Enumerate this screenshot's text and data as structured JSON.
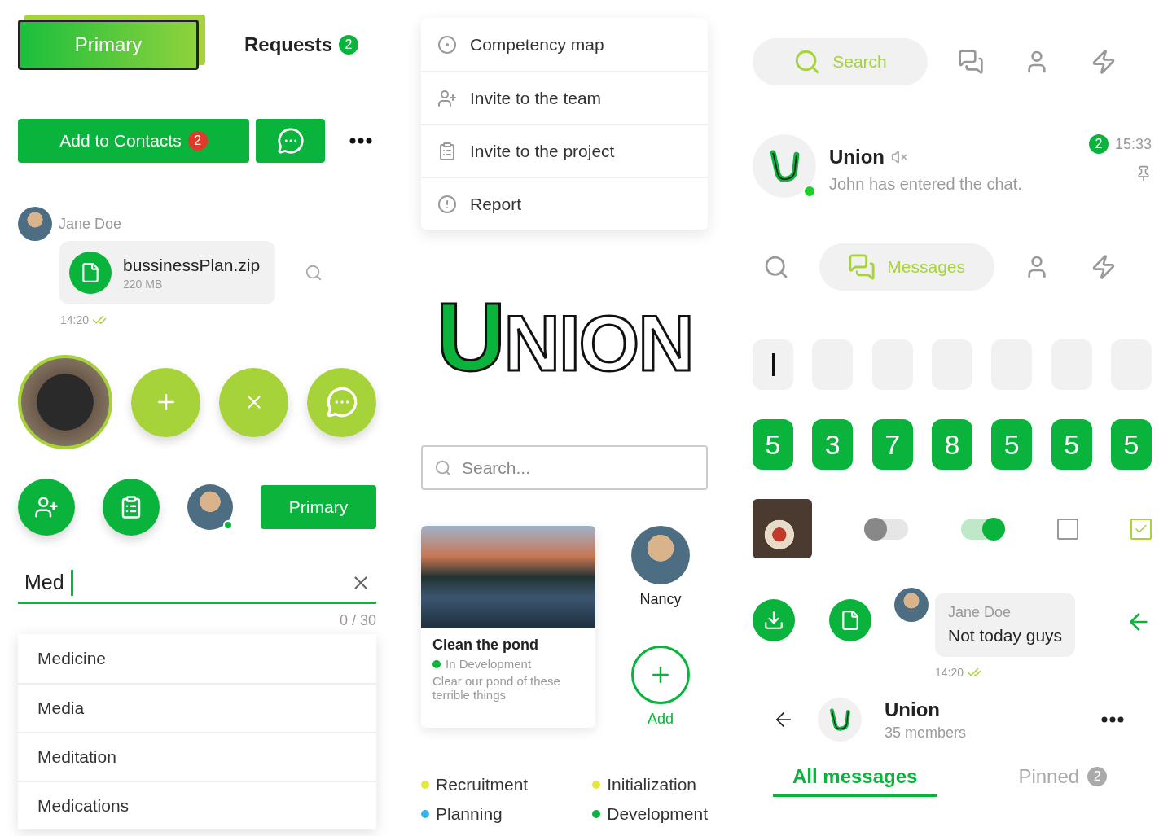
{
  "tabs": [
    {
      "label": "Primary",
      "selected": true
    },
    {
      "label": "Requests",
      "badge": "2",
      "selected": false
    }
  ],
  "contact_actions": {
    "add_label": "Add to Contacts",
    "add_badge": "2"
  },
  "file_message": {
    "sender": "Jane Doe",
    "file_name": "bussinessPlan.zip",
    "file_size": "220 MB",
    "time": "14:20",
    "read": true
  },
  "primary_button": "Primary",
  "text_input": {
    "value": "Med",
    "counter": "0 / 30"
  },
  "suggestions": [
    "Medicine",
    "Media",
    "Meditation",
    "Medications"
  ],
  "menu": [
    {
      "label": "Competency map",
      "kind": "map"
    },
    {
      "label": "Invite to the team",
      "kind": "team"
    },
    {
      "label": "Invite to the project",
      "kind": "project"
    },
    {
      "label": "Report",
      "kind": "report"
    }
  ],
  "logo": "UNION",
  "search": {
    "placeholder": "Search..."
  },
  "project_card": {
    "title": "Clean the pond",
    "status": "In Development",
    "description": "Clear our pond of these terrible things"
  },
  "contact": {
    "name": "Nancy"
  },
  "add_label": "Add",
  "legend": [
    {
      "label": "Recruitment",
      "color": "#e4e83a"
    },
    {
      "label": "Initialization",
      "color": "#e4e83a"
    },
    {
      "label": "Planning",
      "color": "#35b4ea"
    },
    {
      "label": "Development",
      "color": "#0ab43c"
    }
  ],
  "nav_top": [
    {
      "kind": "search",
      "label": "Search",
      "selected": true
    },
    {
      "kind": "chats",
      "selected": false
    },
    {
      "kind": "profile",
      "selected": false
    },
    {
      "kind": "activity",
      "selected": false
    }
  ],
  "chat_item": {
    "name": "Union",
    "muted": true,
    "online": true,
    "last_message": "John has entered the chat.",
    "unread": "2",
    "time": "15:33",
    "pinned": true
  },
  "nav_bottom": [
    {
      "kind": "search",
      "selected": false
    },
    {
      "kind": "chats",
      "label": "Messages",
      "selected": true
    },
    {
      "kind": "profile",
      "selected": false
    },
    {
      "kind": "activity",
      "selected": false
    }
  ],
  "code_empty": [
    {
      "focused": true
    },
    {
      "focused": false
    },
    {
      "focused": false
    },
    {
      "focused": false
    },
    {
      "focused": false
    },
    {
      "focused": false
    },
    {
      "focused": false
    }
  ],
  "code_filled": [
    "5",
    "3",
    "7",
    "8",
    "5",
    "5",
    "5"
  ],
  "controls": [
    {
      "kind": "switch",
      "on": false
    },
    {
      "kind": "switch",
      "on": true
    },
    {
      "kind": "checkbox",
      "checked": false
    },
    {
      "kind": "checkbox",
      "checked": true
    }
  ],
  "reply_message": {
    "sender": "Jane Doe",
    "text": "Not today guys",
    "time": "14:20",
    "read": true
  },
  "group_header": {
    "name": "Union",
    "members": "35 members"
  },
  "message_tabs": [
    {
      "label": "All messages",
      "selected": true
    },
    {
      "label": "Pinned",
      "badge": "2",
      "selected": false
    }
  ]
}
